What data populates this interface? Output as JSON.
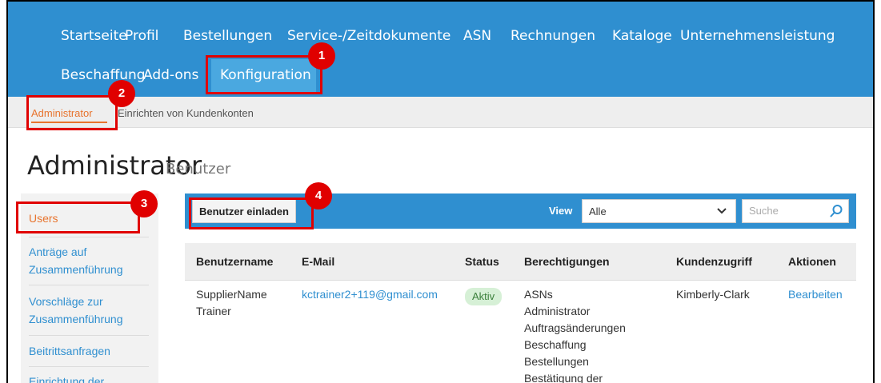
{
  "nav": {
    "items": [
      "Startseite",
      "Profil",
      "Bestellungen",
      "Service-/Zeitdokumente",
      "ASN",
      "Rechnungen",
      "Kataloge",
      "Unternehmensleistung"
    ],
    "row2": [
      "Beschaffung",
      "Add-ons"
    ],
    "active": "Konfiguration"
  },
  "subnav": {
    "items": [
      "Administrator",
      "Einrichten von Kundenkonten"
    ]
  },
  "page": {
    "title": "Administrator",
    "subtitle": "Benutzer"
  },
  "sidebar": {
    "items": [
      "Users",
      "Anträge auf Zusammenführung",
      "Vorschläge zur Zusammenführung",
      "Beitrittsanfragen",
      "Einrichtung der"
    ]
  },
  "toolbar": {
    "invite_label": "Benutzer einladen",
    "view_label": "View",
    "view_value": "Alle",
    "search_placeholder": "Suche"
  },
  "table": {
    "headers": [
      "Benutzername",
      "E-Mail",
      "Status",
      "Berechtigungen",
      "Kundenzugriff",
      "Aktionen"
    ],
    "rows": [
      {
        "username": "SupplierName Trainer",
        "email": "kctrainer2+119@gmail.com",
        "status": "Aktiv",
        "permissions": [
          "ASNs",
          "Administrator",
          "Auftragsänderungen",
          "Beschaffung",
          "Bestellungen",
          "Bestätigung der"
        ],
        "customer": "Kimberly-Clark",
        "action": "Bearbeiten"
      }
    ]
  },
  "annotations": [
    "1",
    "2",
    "3",
    "4"
  ],
  "colors": {
    "nav_bg": "#2f8fd0",
    "accent_orange": "#e8742e",
    "annotation_red": "#e00000"
  }
}
